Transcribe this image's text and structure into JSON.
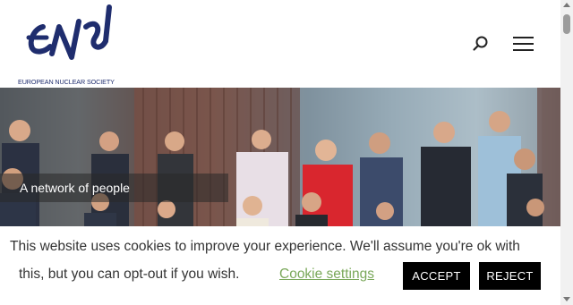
{
  "header": {
    "logo_text": "ENS",
    "logo_subtitle": "EUROPEAN NUCLEAR SOCIETY",
    "icons": {
      "search": "search-icon",
      "menu": "hamburger-menu-icon"
    }
  },
  "hero": {
    "caption": "A network of people"
  },
  "cookie_notice": {
    "line1": "This website uses cookies to improve your experience. We'll assume you're ok with",
    "line2": "this, but you can opt-out if you wish.",
    "settings_link": "Cookie settings",
    "accept_label": "ACCEPT",
    "reject_label": "REJECT"
  },
  "colors": {
    "brand_navy": "#1f2d6e",
    "link_green": "#7aa85a",
    "button_bg": "#000000"
  }
}
